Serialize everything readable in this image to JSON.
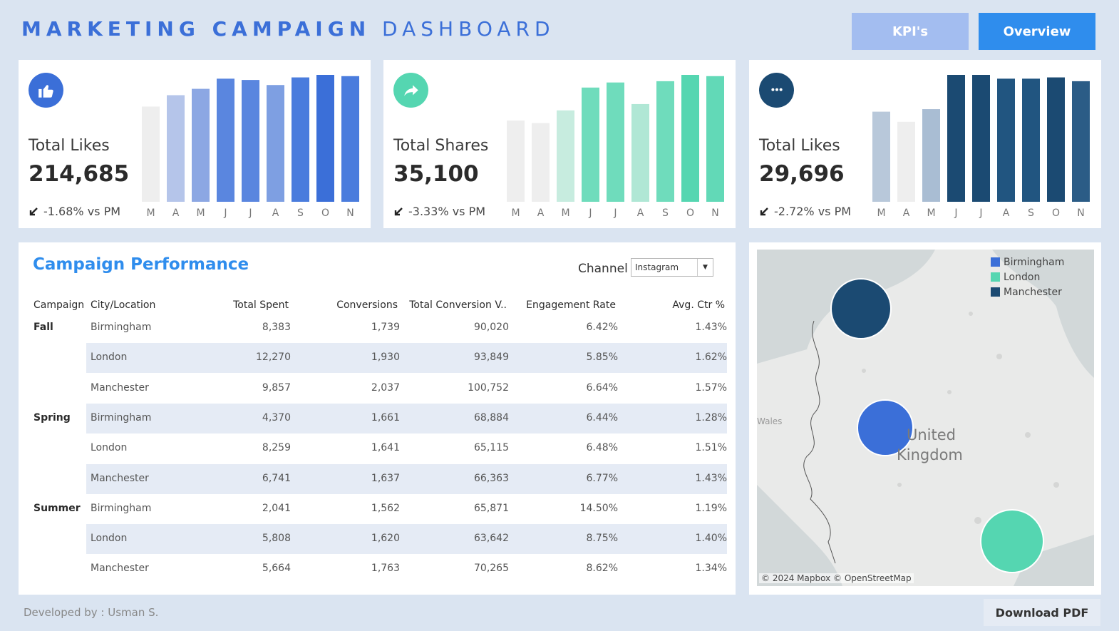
{
  "header": {
    "title_bold": "MARKETING CAMPAIGN",
    "title_light": "DASHBOARD",
    "kpi_button": "KPI's",
    "overview_button": "Overview"
  },
  "kpis": [
    {
      "label": "Total Likes",
      "value": "214,685",
      "delta": "-1.68% vs PM",
      "icon": "thumbs-up-icon",
      "color": "#3b6fd8"
    },
    {
      "label": "Total Shares",
      "value": "35,100",
      "delta": "-3.33% vs PM",
      "icon": "share-icon",
      "color": "#55d6b1"
    },
    {
      "label": "Total Likes",
      "value": "29,696",
      "delta": "-2.72% vs PM",
      "icon": "comment-icon",
      "color": "#1b4a72"
    }
  ],
  "chart_data": [
    {
      "type": "bar",
      "categories": [
        "M",
        "A",
        "M",
        "J",
        "J",
        "A",
        "S",
        "O",
        "N"
      ],
      "values": [
        0.75,
        0.84,
        0.89,
        0.97,
        0.96,
        0.92,
        0.98,
        1.0,
        0.99
      ],
      "colors": [
        "#eeeeee",
        "#b5c5ea",
        "#8ca7e3",
        "#5a86df",
        "#5a86df",
        "#7e9fe2",
        "#4a7cdd",
        "#3b6fd8",
        "#4a7cdd"
      ],
      "ylim": [
        0,
        1
      ]
    },
    {
      "type": "bar",
      "categories": [
        "M",
        "A",
        "M",
        "J",
        "J",
        "A",
        "S",
        "O",
        "N"
      ],
      "values": [
        0.64,
        0.62,
        0.72,
        0.9,
        0.94,
        0.77,
        0.95,
        1.0,
        0.99
      ],
      "colors": [
        "#eeeeee",
        "#eeeeee",
        "#c7ecdf",
        "#6fdcbc",
        "#6fdcbc",
        "#b0e7d5",
        "#6fdcbc",
        "#55d6b1",
        "#62d9b7"
      ],
      "ylim": [
        0,
        1
      ]
    },
    {
      "type": "bar",
      "categories": [
        "M",
        "A",
        "M",
        "J",
        "J",
        "A",
        "S",
        "O",
        "N"
      ],
      "values": [
        0.71,
        0.63,
        0.73,
        1.0,
        1.0,
        0.97,
        0.97,
        0.98,
        0.95
      ],
      "colors": [
        "#b8c8da",
        "#eeeeee",
        "#a9bdd3",
        "#1b4a72",
        "#1b4a72",
        "#215580",
        "#215580",
        "#1b4a72",
        "#2b5c86"
      ],
      "ylim": [
        0,
        1
      ]
    }
  ],
  "performance": {
    "title": "Campaign Performance",
    "channel_label": "Channel",
    "channel_value": "Instagram",
    "columns": [
      "Campaign",
      "City/Location",
      "Total Spent",
      "Conversions",
      "Total Conversion V..",
      "Engagement Rate",
      "Avg. Ctr %"
    ],
    "groups": [
      {
        "campaign": "Fall",
        "rows": [
          {
            "city": "Birmingham",
            "spent": "8,383",
            "conversions": "1,739",
            "conv_value": "90,020",
            "engagement": "6.42%",
            "ctr": "1.43%"
          },
          {
            "city": "London",
            "spent": "12,270",
            "conversions": "1,930",
            "conv_value": "93,849",
            "engagement": "5.85%",
            "ctr": "1.62%"
          },
          {
            "city": "Manchester",
            "spent": "9,857",
            "conversions": "2,037",
            "conv_value": "100,752",
            "engagement": "6.64%",
            "ctr": "1.57%"
          }
        ]
      },
      {
        "campaign": "Spring",
        "rows": [
          {
            "city": "Birmingham",
            "spent": "4,370",
            "conversions": "1,661",
            "conv_value": "68,884",
            "engagement": "6.44%",
            "ctr": "1.28%"
          },
          {
            "city": "London",
            "spent": "8,259",
            "conversions": "1,641",
            "conv_value": "65,115",
            "engagement": "6.48%",
            "ctr": "1.51%"
          },
          {
            "city": "Manchester",
            "spent": "6,741",
            "conversions": "1,637",
            "conv_value": "66,363",
            "engagement": "6.77%",
            "ctr": "1.43%"
          }
        ]
      },
      {
        "campaign": "Summer",
        "rows": [
          {
            "city": "Birmingham",
            "spent": "2,041",
            "conversions": "1,562",
            "conv_value": "65,871",
            "engagement": "14.50%",
            "ctr": "1.19%"
          },
          {
            "city": "London",
            "spent": "5,808",
            "conversions": "1,620",
            "conv_value": "63,642",
            "engagement": "8.75%",
            "ctr": "1.40%"
          },
          {
            "city": "Manchester",
            "spent": "5,664",
            "conversions": "1,763",
            "conv_value": "70,265",
            "engagement": "8.62%",
            "ctr": "1.34%"
          }
        ]
      }
    ]
  },
  "map": {
    "legend": [
      {
        "name": "Birmingham",
        "color": "#3b6fd8"
      },
      {
        "name": "London",
        "color": "#55d6b1"
      },
      {
        "name": "Manchester",
        "color": "#1b4a72"
      }
    ],
    "place_label_line1": "United",
    "place_label_line2": "Kingdom",
    "wales_label": "Wales",
    "credit": "© 2024 Mapbox © OpenStreetMap"
  },
  "footer": {
    "developer": "Developed by : Usman S.",
    "download_button": "Download PDF"
  }
}
